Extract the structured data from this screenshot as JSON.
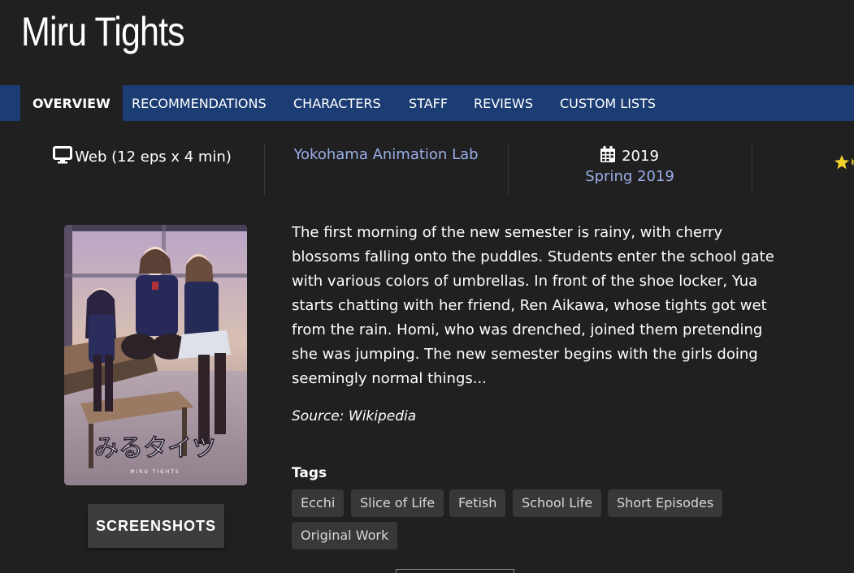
{
  "title": "Miru Tights",
  "tabs": [
    {
      "label": "OVERVIEW",
      "active": true
    },
    {
      "label": "RECOMMENDATIONS"
    },
    {
      "label": "CHARACTERS"
    },
    {
      "label": "STAFF"
    },
    {
      "label": "REVIEWS"
    },
    {
      "label": "CUSTOM LISTS"
    }
  ],
  "info": {
    "format": "Web (12 eps x 4 min)",
    "format_icon": "monitor-icon",
    "studio": "Yokohama Animation Lab",
    "year": "2019",
    "year_icon": "calendar-icon",
    "season": "Spring 2019",
    "rating_icon": "star-icon"
  },
  "poster": {
    "logo_text": "みるタイツ",
    "logo_subtext": "MIRU TIGHTS"
  },
  "screenshots_button": "SCREENSHOTS",
  "synopsis": "The first morning of the new semester is rainy, with cherry blossoms falling onto the puddles. Students enter the school gate with various colors of umbrellas. In front of the shoe locker, Yua starts chatting with her friend, Ren Aikawa, whose tights got wet from the rain. Homi, who was drenched, joined them pretending she was jumping. The new semester begins with the girls doing seemingly normal things...",
  "source": "Source: Wikipedia",
  "tags_label": "Tags",
  "tags": [
    "Ecchi",
    "Slice of Life",
    "Fetish",
    "School Life",
    "Short Episodes",
    "Original Work"
  ],
  "colors": {
    "background": "#202020",
    "tab_bar": "#1c3d73",
    "link": "#9aaee8",
    "tag_bg": "#383838",
    "star": "#f2d22a"
  }
}
